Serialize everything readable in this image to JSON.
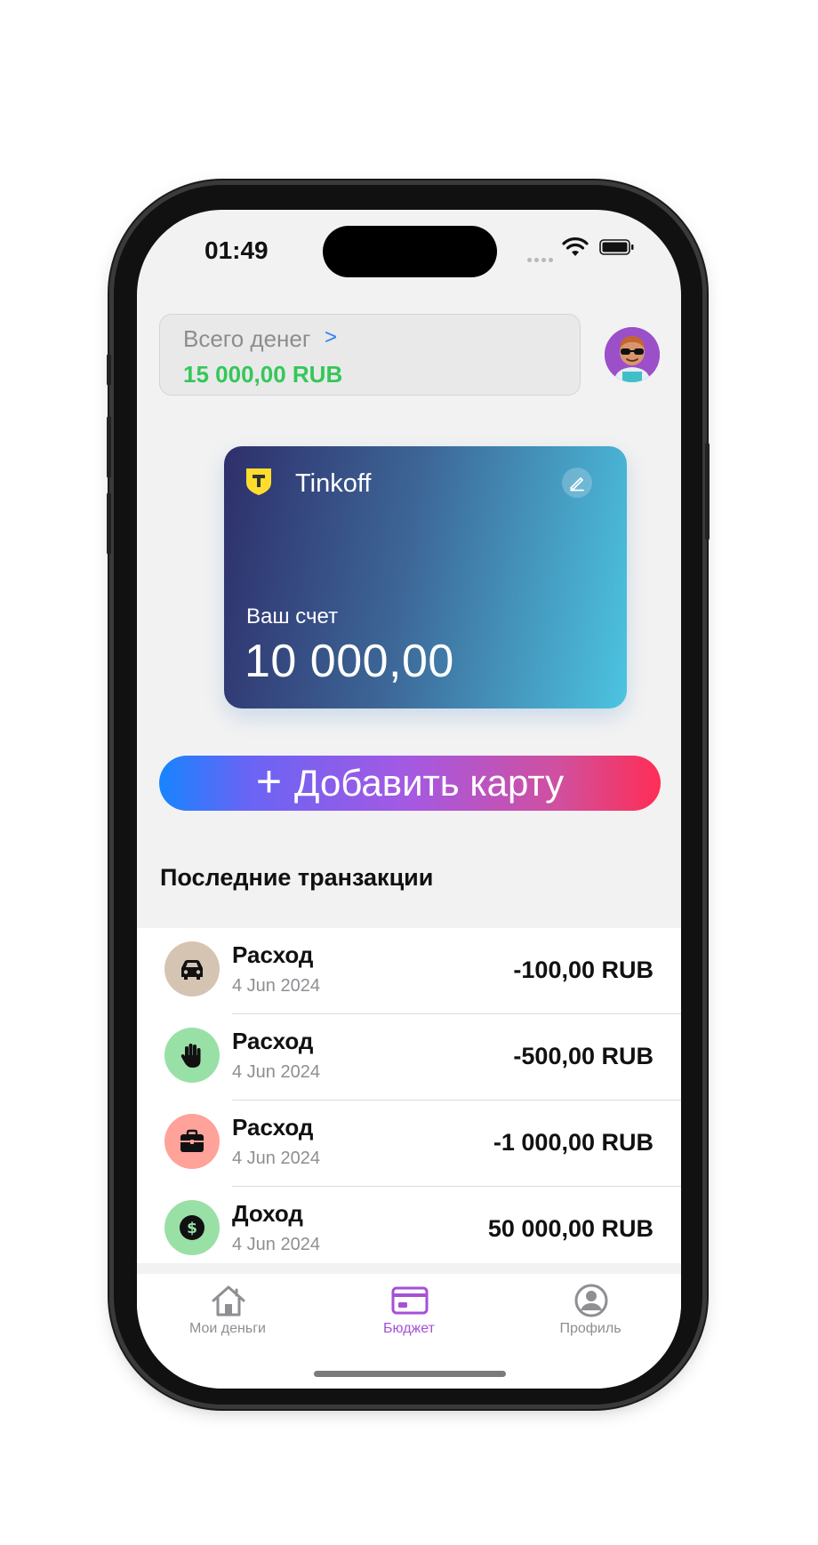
{
  "status_bar": {
    "time": "01:49"
  },
  "summary": {
    "label": "Всего денег",
    "chevron": ">",
    "amount": "15 000,00 RUB",
    "amount_color": "#34c759"
  },
  "profile": {
    "avatar": "memoji-avatar"
  },
  "card": {
    "bank_name": "Tinkoff",
    "logo_icon": "tinkoff-shield-icon",
    "edit_icon": "pencil-icon",
    "balance_label": "Ваш счет",
    "balance": "10 000,00"
  },
  "add_card": {
    "plus": "+",
    "label": "Добавить карту"
  },
  "transactions": {
    "title": "Последние транзакции",
    "items": [
      {
        "type": "Расход",
        "date": "4 Jun 2024",
        "amount": "-100,00 RUB",
        "icon": "car-icon",
        "icon_bg": "#d6c4b3"
      },
      {
        "type": "Расход",
        "date": "4 Jun 2024",
        "amount": "-500,00 RUB",
        "icon": "hand-icon",
        "icon_bg": "#99e0a6"
      },
      {
        "type": "Расход",
        "date": "4 Jun 2024",
        "amount": "-1 000,00 RUB",
        "icon": "briefcase-icon",
        "icon_bg": "#ffa29a"
      },
      {
        "type": "Доход",
        "date": "4 Jun 2024",
        "amount": "50 000,00 RUB",
        "icon": "dollar-icon",
        "icon_bg": "#99e0a6"
      }
    ]
  },
  "tab_bar": {
    "active_color": "#a64fd8",
    "tabs": [
      {
        "label": "Мои деньги",
        "icon": "house-icon",
        "active": false
      },
      {
        "label": "Бюджет",
        "icon": "credit-card-icon",
        "active": true
      },
      {
        "label": "Профиль",
        "icon": "person-circle-icon",
        "active": false
      }
    ]
  }
}
